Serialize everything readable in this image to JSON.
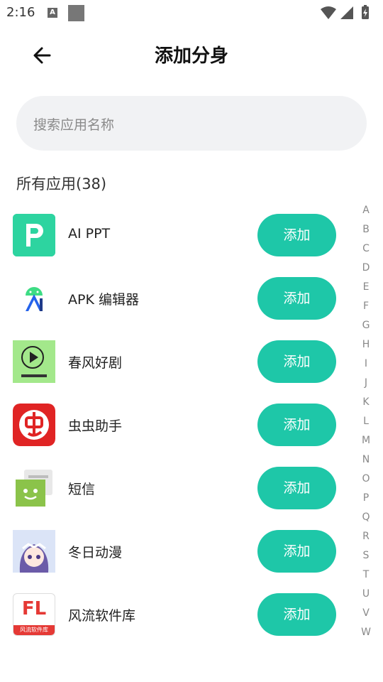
{
  "status_bar": {
    "time": "2:16",
    "notif_icon_letter": "A"
  },
  "header": {
    "title": "添加分身"
  },
  "search": {
    "placeholder": "搜索应用名称"
  },
  "section": {
    "label": "所有应用(38)"
  },
  "apps": [
    {
      "name": "AI PPT",
      "add_label": "添加",
      "icon": "pptx-p-icon",
      "icon_color": "#2dd4a0"
    },
    {
      "name": "APK 编辑器",
      "add_label": "添加",
      "icon": "android-apk-editor-icon",
      "icon_color": "#3b82f6"
    },
    {
      "name": "春风好剧",
      "add_label": "添加",
      "icon": "play-circle-icon",
      "icon_color": "#a3e88b"
    },
    {
      "name": "虫虫助手",
      "add_label": "添加",
      "icon": "chongchong-icon",
      "icon_color": "#e02424"
    },
    {
      "name": "短信",
      "add_label": "添加",
      "icon": "sms-icon",
      "icon_color": "#8bc34a"
    },
    {
      "name": "冬日动漫",
      "add_label": "添加",
      "icon": "winter-anime-icon",
      "icon_color": "#7a6bbf"
    },
    {
      "name": "风流软件库",
      "add_label": "添加",
      "icon": "fl-library-icon",
      "icon_color": "#e53935",
      "icon_text": "FL",
      "icon_subtext": "风流软件库"
    }
  ],
  "alpha_index": [
    "A",
    "B",
    "C",
    "D",
    "E",
    "F",
    "G",
    "H",
    "I",
    "J",
    "K",
    "L",
    "M",
    "N",
    "O",
    "P",
    "Q",
    "R",
    "S",
    "T",
    "U",
    "V",
    "W"
  ],
  "colors": {
    "accent": "#1ec7a8",
    "search_bg": "#f1f2f4"
  }
}
